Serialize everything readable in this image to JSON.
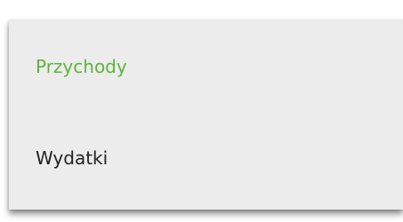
{
  "menu": {
    "items": [
      {
        "label": "Przychody",
        "state": "selected",
        "color": "#5fb439"
      },
      {
        "label": "Wydatki",
        "state": "default",
        "color": "#222222"
      }
    ]
  }
}
